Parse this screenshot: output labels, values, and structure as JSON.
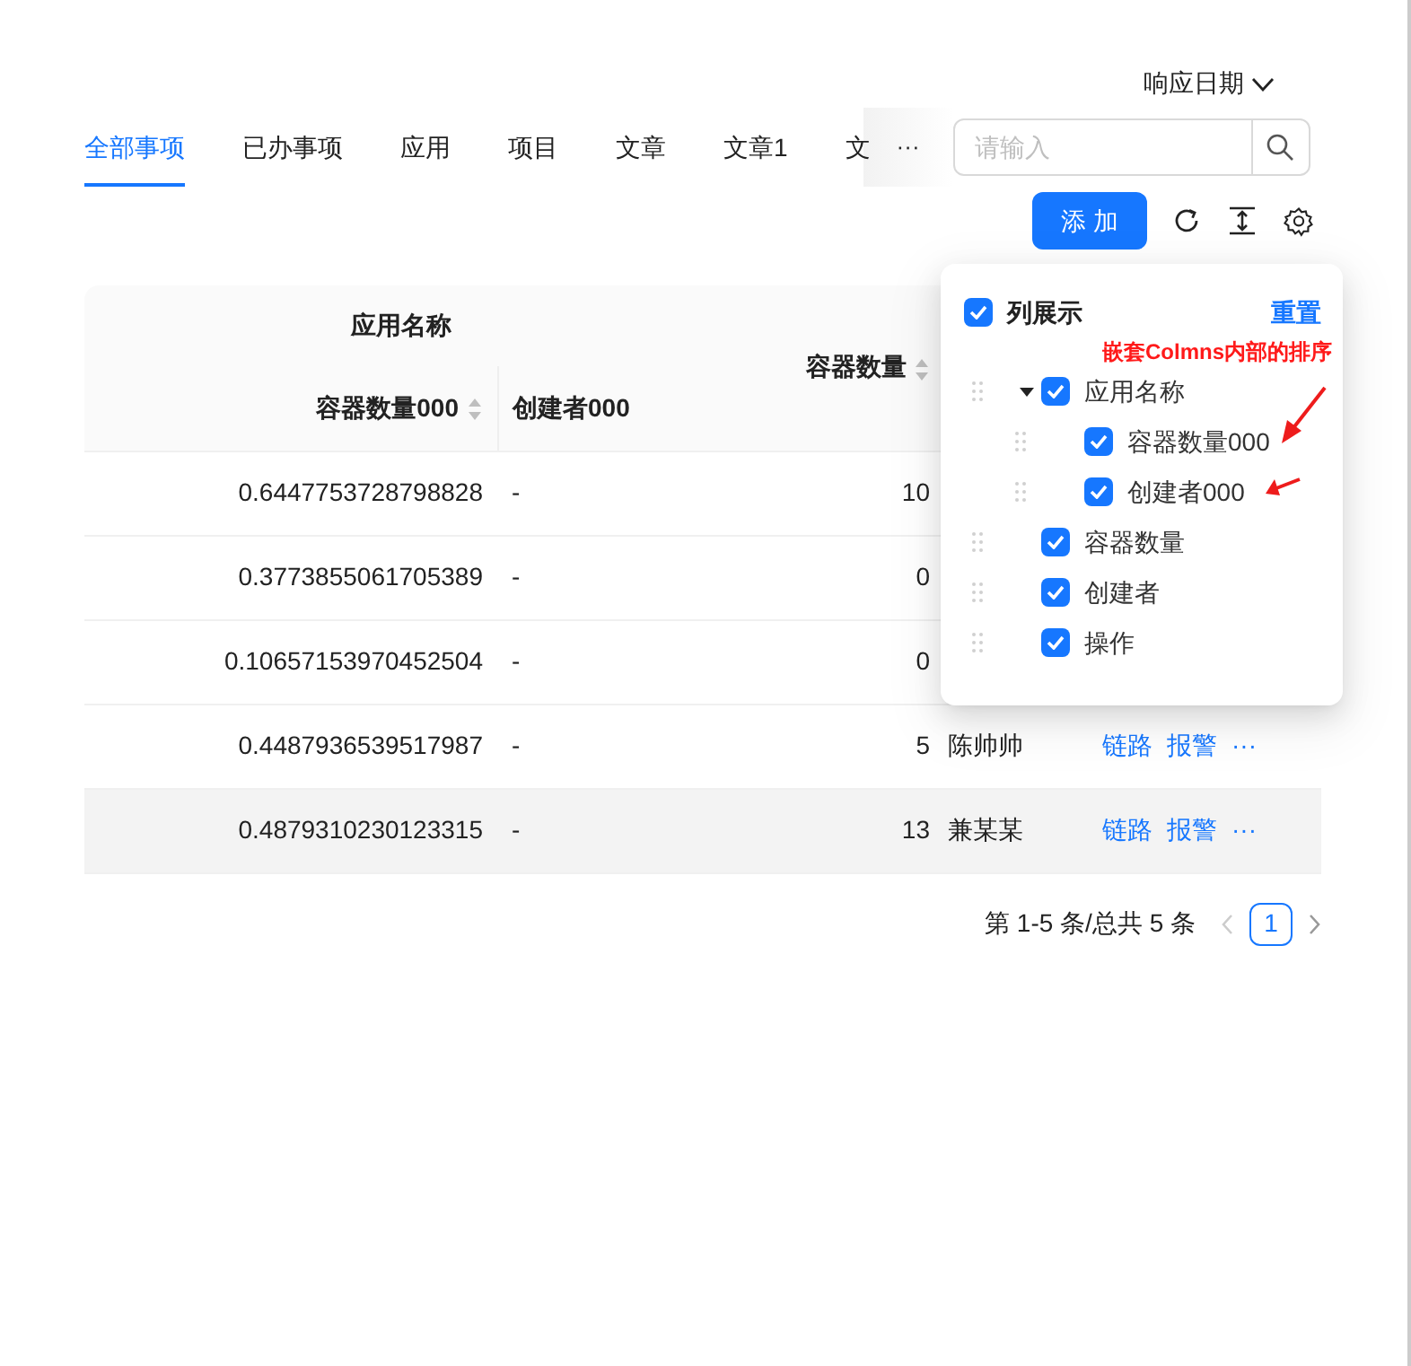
{
  "date_filter": {
    "label": "响应日期"
  },
  "tabs": [
    {
      "label": "全部事项",
      "selected": true
    },
    {
      "label": "已办事项",
      "selected": false
    },
    {
      "label": "应用",
      "selected": false
    },
    {
      "label": "项目",
      "selected": false
    },
    {
      "label": "文章",
      "selected": false
    },
    {
      "label": "文章1",
      "selected": false
    },
    {
      "label": "文",
      "selected": false
    }
  ],
  "more_tabs": "···",
  "search": {
    "placeholder": "请输入"
  },
  "add_button": "添 加",
  "table": {
    "group_header": "应用名称",
    "columns": [
      "容器数量000",
      "创建者000",
      "容器数量"
    ],
    "rows": [
      {
        "cells": [
          "0.6447753728798828",
          "-",
          "10"
        ],
        "hovered": false
      },
      {
        "cells": [
          "0.3773855061705389",
          "-",
          "0"
        ],
        "hovered": false
      },
      {
        "cells": [
          "0.10657153970452504",
          "-",
          "0"
        ],
        "hovered": false
      },
      {
        "cells": [
          "0.4487936539517987",
          "-",
          "5",
          "陈帅帅"
        ],
        "actions": [
          "链路",
          "报警",
          "···"
        ],
        "hovered": false
      },
      {
        "cells": [
          "0.4879310230123315",
          "-",
          "13",
          "兼某某"
        ],
        "actions": [
          "链路",
          "报警",
          "···"
        ],
        "hovered": true
      }
    ]
  },
  "pagination": {
    "summary": "第 1-5 条/总共 5 条",
    "pages": [
      {
        "label": "1",
        "selected": true
      }
    ],
    "prev_disabled": true,
    "next_disabled": false
  },
  "column_settings": {
    "title": "列展示",
    "checked": true,
    "reset": "重置",
    "annotation": "嵌套Colmns内部的排序",
    "items": [
      {
        "label": "应用名称",
        "checked": true,
        "expanded": true,
        "children": [
          {
            "label": "容器数量000",
            "checked": true
          },
          {
            "label": "创建者000",
            "checked": true
          }
        ]
      },
      {
        "label": "容器数量",
        "checked": true
      },
      {
        "label": "创建者",
        "checked": true
      },
      {
        "label": "操作",
        "checked": true
      }
    ]
  }
}
